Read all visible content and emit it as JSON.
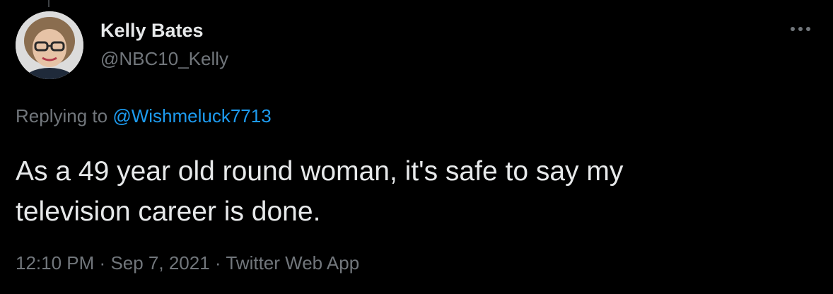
{
  "author": {
    "name": "Kelly Bates",
    "handle": "@NBC10_Kelly"
  },
  "reply_context": {
    "prefix": "Replying to",
    "mention": "@Wishmeluck7713"
  },
  "tweet": {
    "line1": "As a 49 year old round woman, it's safe to say my",
    "line2": "television career is done."
  },
  "meta": {
    "time": "12:10 PM",
    "separator": "·",
    "date": "Sep 7, 2021",
    "source": "Twitter Web App"
  },
  "icons": {
    "more": "more-horizontal-icon"
  },
  "colors": {
    "background": "#000000",
    "text_primary": "#e7e9ea",
    "text_secondary": "#71767b",
    "link": "#1d9bf0"
  }
}
